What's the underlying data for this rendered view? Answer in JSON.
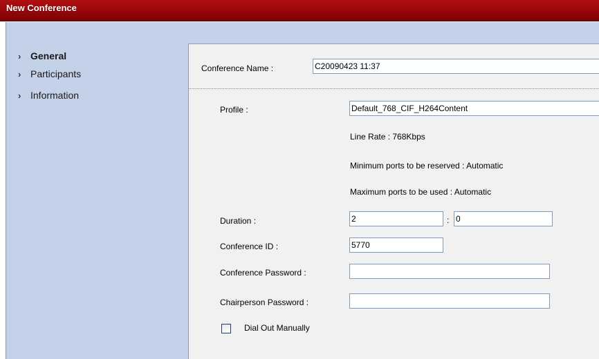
{
  "window": {
    "title": "New Conference"
  },
  "nav": {
    "items": [
      {
        "label": "General",
        "active": true
      },
      {
        "label": "Participants",
        "active": false
      },
      {
        "label": "Information",
        "active": false
      }
    ]
  },
  "form": {
    "conference_name": {
      "label": "Conference Name :",
      "value": "C20090423 11:37"
    },
    "profile": {
      "label": "Profile :",
      "value": "Default_768_CIF_H264Content"
    },
    "line_rate": "Line Rate : 768Kbps",
    "min_ports": "Minimum ports to be reserved : Automatic",
    "max_ports": "Maximum ports to be used : Automatic",
    "duration": {
      "label": "Duration :",
      "hours": "2",
      "separator": ":",
      "minutes": "0"
    },
    "conference_id": {
      "label": "Conference ID :",
      "value": "5770"
    },
    "conference_password": {
      "label": "Conference Password :",
      "value": ""
    },
    "chairperson_password": {
      "label": "Chairperson Password :",
      "value": ""
    },
    "dial_out_manually": {
      "label": "Dial Out Manually",
      "checked": false
    }
  },
  "colors": {
    "titlebar": "#970608",
    "nav_bg": "#c3d1e9",
    "panel_bg": "#f1f1f1",
    "field_border": "#7f9db9"
  }
}
